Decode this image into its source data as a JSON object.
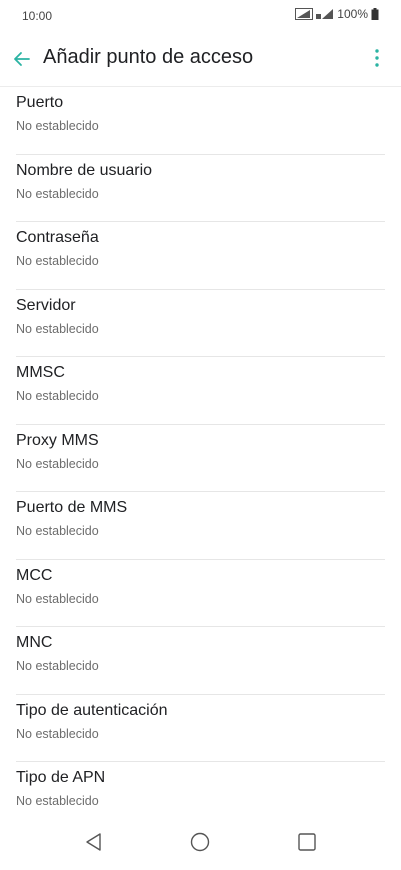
{
  "status_bar": {
    "time": "10:00",
    "battery": "100%"
  },
  "header": {
    "title": "Añadir punto de acceso"
  },
  "items": [
    {
      "label": "Puerto",
      "value": "No establecido"
    },
    {
      "label": "Nombre de usuario",
      "value": "No establecido"
    },
    {
      "label": "Contraseña",
      "value": "No establecido"
    },
    {
      "label": "Servidor",
      "value": "No establecido"
    },
    {
      "label": "MMSC",
      "value": "No establecido"
    },
    {
      "label": "Proxy MMS",
      "value": "No establecido"
    },
    {
      "label": "Puerto de MMS",
      "value": "No establecido"
    },
    {
      "label": "MCC",
      "value": "No establecido"
    },
    {
      "label": "MNC",
      "value": "No establecido"
    },
    {
      "label": "Tipo de autenticación",
      "value": "No establecido"
    },
    {
      "label": "Tipo de APN",
      "value": "No establecido"
    }
  ],
  "colors": {
    "accent": "#2bb3a3",
    "text_primary": "#202124",
    "text_secondary": "#6d6d6d"
  }
}
